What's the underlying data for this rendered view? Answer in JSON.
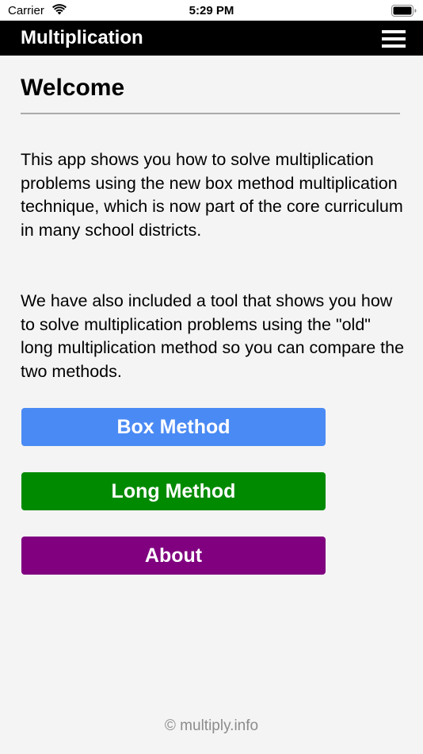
{
  "status_bar": {
    "carrier": "Carrier",
    "time": "5:29 PM"
  },
  "nav": {
    "title": "Multiplication",
    "menu_icon": "hamburger-menu-icon"
  },
  "main": {
    "heading": "Welcome",
    "paragraph1": "This app shows you how to solve multiplication problems using the new box method multiplication technique, which is now part of the core curriculum in many school districts.",
    "paragraph2": "We have also included a tool that shows you how to solve multiplication problems using the \"old\" long multiplication method so you can compare the two methods."
  },
  "buttons": {
    "box_method": "Box Method",
    "long_method": "Long Method",
    "about": "About"
  },
  "colors": {
    "box_method": "#4a8af4",
    "long_method": "#008a00",
    "about": "#800080",
    "nav_bar": "#000000"
  },
  "footer": {
    "copyright": "© multiply.info"
  }
}
